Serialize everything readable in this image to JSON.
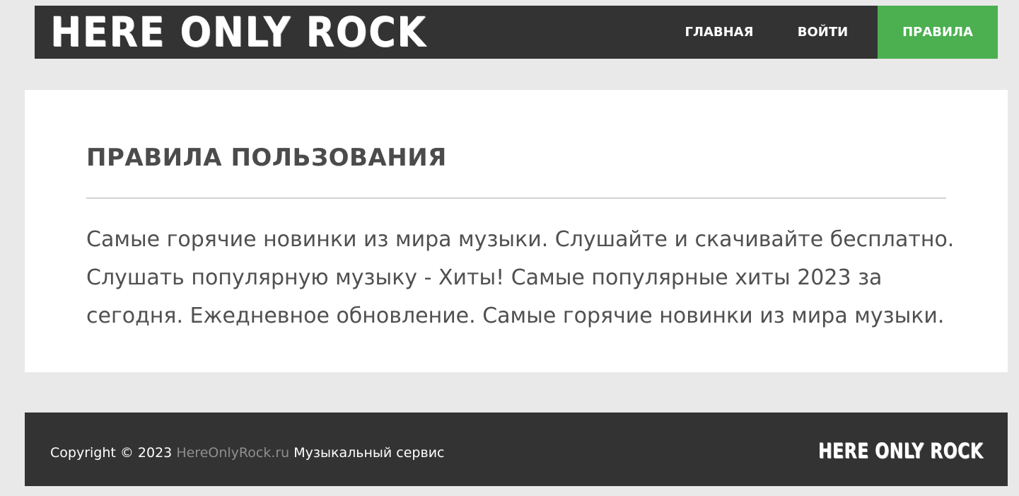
{
  "header": {
    "logo_text": "HERE ONLY ROCK",
    "nav": {
      "home": "ГЛАВНАЯ",
      "login": "ВОЙТИ",
      "rules": "ПРАВИЛА"
    },
    "active_color": "#4caf50"
  },
  "main": {
    "title": "ПРАВИЛА ПОЛЬЗОВАНИЯ",
    "body": "Самые горячие новинки из мира музыки. Слушайте и скачивайте бесплатно. Слушать популярную музыку - Хиты! Самые популярные хиты 2023 за сегодня. Ежедневное обновление. Самые горячие новинки из мира музыки."
  },
  "footer": {
    "copyright_prefix": "Copyright © 2023",
    "site_link": "HereOnlyRock.ru",
    "copyright_suffix": "Музыкальный сервис",
    "logo_text": "HERE ONLY ROCK"
  },
  "colors": {
    "background": "#e8e9e8",
    "header_bg": "#333333",
    "accent": "#4caf50",
    "text": "#505050"
  }
}
